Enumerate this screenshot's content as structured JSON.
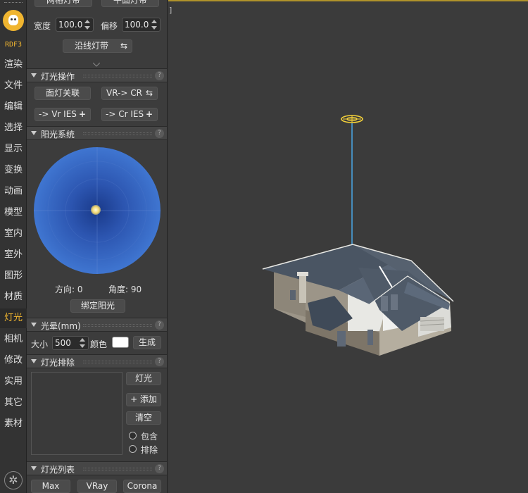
{
  "strip": {
    "brand": "RDF3",
    "items": [
      {
        "id": "render",
        "label": "渲染"
      },
      {
        "id": "file",
        "label": "文件"
      },
      {
        "id": "edit",
        "label": "编辑"
      },
      {
        "id": "select",
        "label": "选择"
      },
      {
        "id": "display",
        "label": "显示"
      },
      {
        "id": "transform",
        "label": "变换"
      },
      {
        "id": "animation",
        "label": "动画"
      },
      {
        "id": "model",
        "label": "模型"
      },
      {
        "id": "interior",
        "label": "室内"
      },
      {
        "id": "exterior",
        "label": "室外"
      },
      {
        "id": "shape",
        "label": "图形"
      },
      {
        "id": "material",
        "label": "材质"
      },
      {
        "id": "light",
        "label": "灯光",
        "active": true
      },
      {
        "id": "camera",
        "label": "相机"
      },
      {
        "id": "modify",
        "label": "修改"
      },
      {
        "id": "utility",
        "label": "实用"
      },
      {
        "id": "other",
        "label": "其它"
      },
      {
        "id": "assets",
        "label": "素材"
      }
    ]
  },
  "strip_panel": {
    "top_buttons": [
      "网格灯带",
      "平面灯带"
    ],
    "width_label": "宽度",
    "width_value": "100.0",
    "offset_label": "偏移",
    "offset_value": "100.0",
    "along_line_label": "沿线灯带"
  },
  "light_ops": {
    "title": "灯光操作",
    "help": "?",
    "face_link": "面灯关联",
    "vr_to_cr": "VR-> CR",
    "to_vr_ies": "-> Vr IES",
    "to_cr_ies": "-> Cr IES"
  },
  "sun": {
    "title": "阳光系统",
    "help": "?",
    "direction_label": "方向:",
    "direction_value": "0",
    "angle_label": "角度:",
    "angle_value": "90",
    "bind_button": "绑定阳光"
  },
  "halo": {
    "title": "光晕(mm)",
    "help": "?",
    "size_label": "大小",
    "size_value": "500",
    "color_label": "颜色",
    "color": "#ffffff",
    "generate_button": "生成"
  },
  "exclude": {
    "title": "灯光排除",
    "help": "?",
    "light_button": "灯光",
    "add_button": "+ 添加",
    "clear_button": "清空",
    "include_label": "包含",
    "exclude_label": "排除"
  },
  "light_list": {
    "title": "灯光列表",
    "help": "?",
    "buttons": [
      "Max",
      "VRay",
      "Corona"
    ]
  },
  "viewport": {
    "bracket": "]"
  },
  "colors": {
    "accent": "#f0b530",
    "light_gizmo": "#f5d23a",
    "light_line": "#4aa8e8"
  }
}
